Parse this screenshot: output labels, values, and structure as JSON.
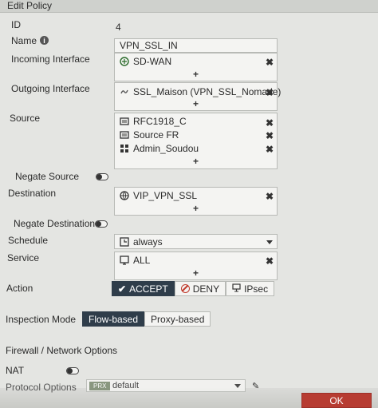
{
  "header": {
    "title": "Edit Policy"
  },
  "id": {
    "label": "ID",
    "value": "4"
  },
  "name": {
    "label": "Name",
    "value": "VPN_SSL_IN"
  },
  "incoming": {
    "label": "Incoming Interface",
    "items": [
      "SD-WAN"
    ]
  },
  "outgoing": {
    "label": "Outgoing Interface",
    "items": [
      "SSL_Maison (VPN_SSL_Nomade)"
    ]
  },
  "source": {
    "label": "Source",
    "items": [
      "RFC1918_C",
      "Source FR",
      "Admin_Soudou"
    ]
  },
  "negate_source": {
    "label": "Negate Source",
    "enabled": false
  },
  "destination": {
    "label": "Destination",
    "items": [
      "VIP_VPN_SSL"
    ]
  },
  "negate_destination": {
    "label": "Negate Destination",
    "enabled": false
  },
  "schedule": {
    "label": "Schedule",
    "value": "always"
  },
  "service": {
    "label": "Service",
    "items": [
      "ALL"
    ]
  },
  "action": {
    "label": "Action",
    "options": [
      "ACCEPT",
      "DENY",
      "IPsec"
    ],
    "selected": "ACCEPT"
  },
  "inspection": {
    "label": "Inspection Mode",
    "options": [
      "Flow-based",
      "Proxy-based"
    ],
    "selected": "Flow-based"
  },
  "firewall_section": {
    "title": "Firewall / Network Options"
  },
  "nat": {
    "label": "NAT",
    "enabled": false
  },
  "protocol_options": {
    "label": "Protocol Options",
    "badge": "PRX",
    "value": "default"
  },
  "footer": {
    "ok_label": "OK"
  },
  "symbols": {
    "plus": "+",
    "remove": "✖"
  },
  "colors": {
    "accent": "#2f3d4a",
    "ok": "#b73c32",
    "deny": "#c0392b"
  }
}
